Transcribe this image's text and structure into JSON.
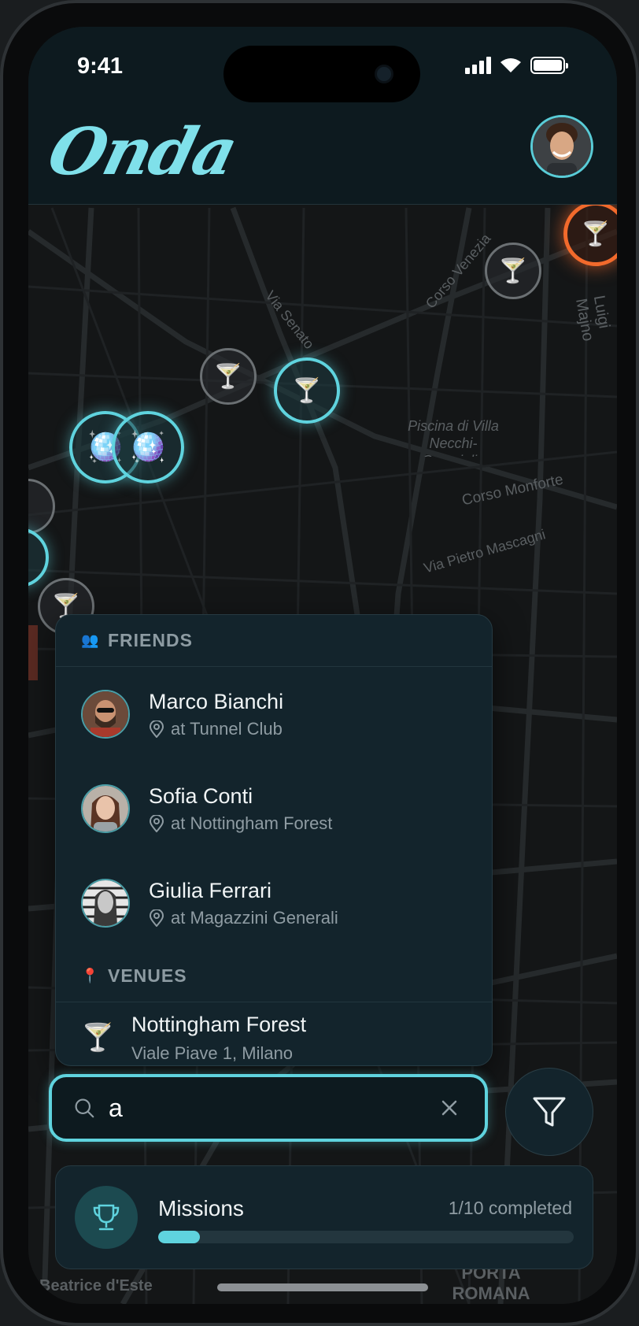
{
  "status_bar": {
    "time": "9:41"
  },
  "header": {
    "logo": "Onda"
  },
  "map": {
    "streets": [
      "Via Senato",
      "Corso Venezia",
      "Luigi Majno",
      "Corso Monforte",
      "Via Pietro Mascagni",
      "Beatrice d'Este"
    ],
    "places": [
      "Piscina di Villa Necchi-Campiglio",
      "PORTA ROMANA"
    ],
    "markers": [
      {
        "icon": "cocktail-icon",
        "style": "gray"
      },
      {
        "icon": "cocktail-icon",
        "style": "teal"
      },
      {
        "icon": "disco-ball-icon",
        "style": "teal"
      },
      {
        "icon": "disco-ball-icon",
        "style": "teal"
      },
      {
        "icon": "cocktail-icon",
        "style": "gray"
      },
      {
        "icon": "cocktail-icon",
        "style": "orange"
      }
    ]
  },
  "search_results": {
    "friends_section": {
      "icon": "people-icon",
      "title": "FRIENDS"
    },
    "friends": [
      {
        "name": "Marco Bianchi",
        "location": "at Tunnel Club"
      },
      {
        "name": "Sofia Conti",
        "location": "at Nottingham Forest"
      },
      {
        "name": "Giulia Ferrari",
        "location": "at Magazzini Generali"
      }
    ],
    "venues_section": {
      "icon": "pin-icon",
      "title": "VENUES"
    },
    "venues": [
      {
        "name": "Nottingham Forest",
        "address": "Viale Piave 1, Milano",
        "icon": "cocktail-icon"
      }
    ]
  },
  "search": {
    "value": "a",
    "placeholder": ""
  },
  "missions": {
    "title": "Missions",
    "status": "1/10 completed",
    "progress": 0.1
  },
  "colors": {
    "accent": "#5fd3de",
    "hot": "#f26a2c",
    "panel": "#13242c"
  }
}
